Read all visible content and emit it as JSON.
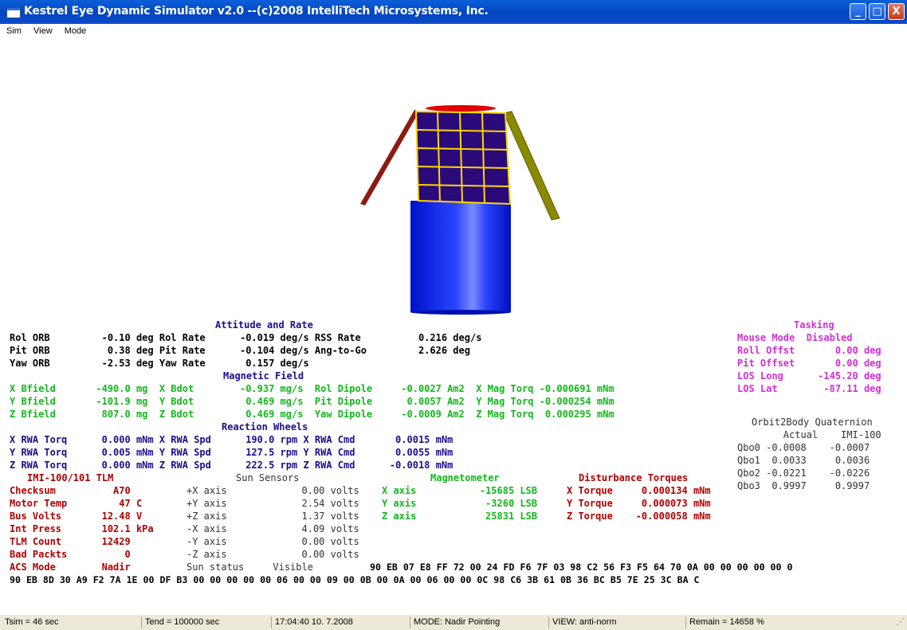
{
  "window": {
    "title": "Kestrel Eye Dynamic Simulator v2.0 --(c)2008 IntelliTech Microsystems, Inc.",
    "buttons": {
      "minimize": "_",
      "maximize": "□",
      "close": "X"
    }
  },
  "menu": [
    "Sim",
    "View",
    "Mode"
  ],
  "attitude": {
    "header": "Attitude and Rate",
    "rows": [
      "Rol ORB         -0.10 deg Rol Rate      -0.019 deg/s RSS Rate          0.216 deg/s",
      "Pit ORB          0.38 deg Pit Rate      -0.104 deg/s Ang-to-Go         2.626 deg",
      "Yaw ORB         -2.53 deg Yaw Rate       0.157 deg/s"
    ]
  },
  "magnetic": {
    "header": "Magnetic Field",
    "rows": [
      "X Bfield       -490.0 mg  X Bdot        -0.937 mg/s  Rol Dipole     -0.0027 Am2  X Mag Torq -0.000691 mNm",
      "Y Bfield       -101.9 mg  Y Bdot         0.469 mg/s  Pit Dipole      0.0057 Am2  Y Mag Torq -0.000254 mNm",
      "Z Bfield        807.0 mg  Z Bdot         0.469 mg/s  Yaw Dipole     -0.0009 Am2  Z Mag Torq  0.000295 mNm"
    ]
  },
  "wheels": {
    "header": "Reaction Wheels",
    "rows": [
      "X RWA Torq      0.000 mNm X RWA Spd      190.0 rpm X RWA Cmd       0.0015 mNm",
      "Y RWA Torq      0.005 mNm Y RWA Spd      127.5 rpm Y RWA Cmd       0.0055 mNm",
      "Z RWA Torq      0.000 mNm Z RWA Spd      222.5 rpm Z RWA Cmd      -0.0018 mNm"
    ]
  },
  "imi": {
    "header": "IMI-100/101 TLM",
    "rows": [
      "Checksum          A70",
      "Motor Temp         47 C",
      "Bus Volts       12.48 V",
      "Int Press       102.1 kPa",
      "TLM Count       12429",
      "Bad Packts          0",
      "ACS Mode        Nadir"
    ]
  },
  "sun": {
    "header": "Sun Sensors",
    "rows": [
      "+X axis             0.00 volts",
      "+Y axis             2.54 volts",
      "+Z axis             1.37 volts",
      "-X axis             4.09 volts",
      "-Y axis             0.00 volts",
      "-Z axis             0.00 volts",
      "Sun status     Visible"
    ]
  },
  "mag_sensor": {
    "header": "Magnetometer",
    "rows": [
      "X axis           -15685 LSB",
      "Y axis            -3260 LSB",
      "Z axis            25831 LSB"
    ]
  },
  "disturbance": {
    "header": "Disturbance Torques",
    "rows": [
      "X Torque     0.000134 mNm",
      "Y Torque     0.000073 mNm",
      "Z Torque    -0.000058 mNm"
    ]
  },
  "tasking": {
    "header": "Tasking",
    "rows": [
      "Mouse Mode  Disabled",
      "Roll Offst       0.00 deg",
      "Pit Offset       0.00 deg",
      "LOS Long      -145.20 deg",
      "LOS Lat        -87.11 deg"
    ]
  },
  "quaternion": {
    "header": "Orbit2Body Quaternion",
    "cols": "        Actual    IMI-100",
    "rows": [
      "Qbo0 -0.0008    -0.0007",
      "Qbo1  0.0033     0.0036",
      "Qbo2 -0.0221    -0.0226",
      "Qbo3  0.9997     0.9997"
    ]
  },
  "hex": {
    "line1": "90 EB 07 E8 FF 72 00 24 FD F6 7F 03 98 C2 56 F3 F5 64 70 0A 00 00 00 00 00 0",
    "line2": "90 EB 8D 30 A9 F2 7A 1E 00 DF B3 00 00 00 00 00 06 00 00 09 00 0B 00 0A 00 06 00 00 0C 98 C6 3B 61 0B 36 BC B5 7E 25 3C BA C"
  },
  "status": {
    "tsim": "Tsim =     46 sec",
    "tend": "Tend = 100000 sec",
    "time": "17:04:40  10. 7.2008",
    "mode": "MODE: Nadir Pointing",
    "view": "VIEW: anti-norm",
    "remain": "Remain =      14658 %"
  },
  "colors": {
    "label_text": "#000000",
    "section_header": "#1b0e8a",
    "magnetic_values": "#12b81c",
    "imi_telemetry": "#b00000",
    "tasking": "#d42ed6",
    "satellite_body": "#0033ff",
    "solar_cell": "#2a0a7a",
    "solar_grid": "#ffd700",
    "antenna": "#8b1a10",
    "top_disc": "#e00000"
  }
}
